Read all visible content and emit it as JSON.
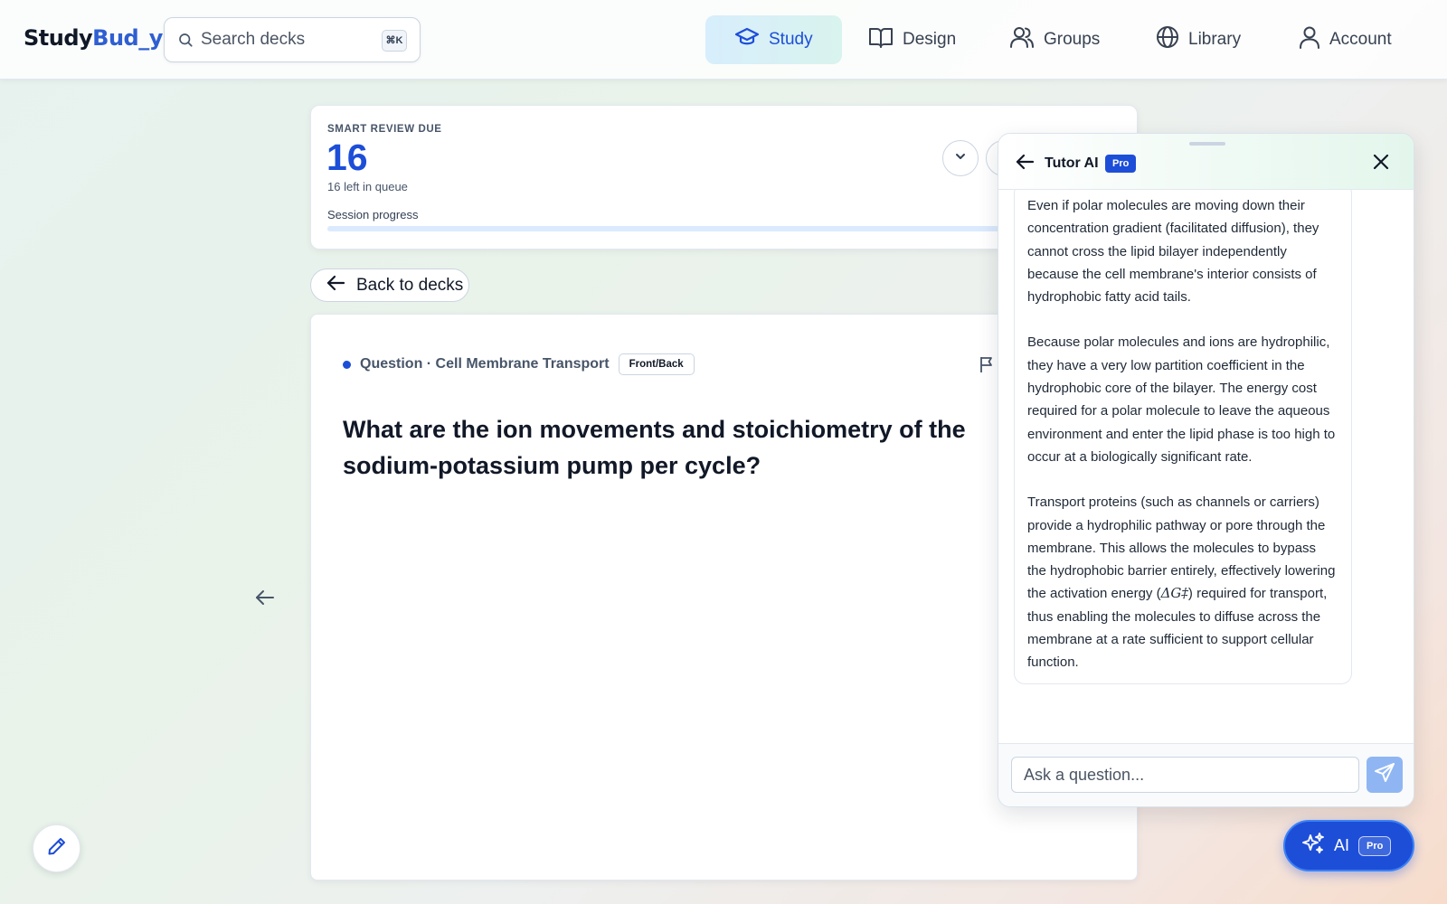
{
  "app": {
    "logo_part1": "Study",
    "logo_part2": "Bud",
    "logo_part3": "_y"
  },
  "search": {
    "placeholder": "Search decks",
    "shortcut": "⌘K"
  },
  "nav": {
    "items": [
      {
        "label": "Study",
        "icon": "graduation-cap-icon",
        "active": true
      },
      {
        "label": "Design",
        "icon": "book-open-icon"
      },
      {
        "label": "Groups",
        "icon": "users-icon"
      },
      {
        "label": "Library",
        "icon": "globe-icon"
      },
      {
        "label": "Account",
        "icon": "user-icon"
      }
    ]
  },
  "review": {
    "label": "SMART REVIEW DUE",
    "count": "16",
    "queue_text": "16 left in queue",
    "progress_label": "Session progress",
    "progress_fraction": 0.0
  },
  "back_button": {
    "label": "Back to decks"
  },
  "card": {
    "meta": "Question · Cell Membrane Transport",
    "type_chip": "Front/Back",
    "question": "What are the ion movements and stoichiometry of the sodium-potassium pump per cycle?"
  },
  "tutor": {
    "title": "Tutor AI",
    "badge": "Pro",
    "paragraphs": [
      "Even if polar molecules are moving down their concentration gradient (facilitated diffusion), they cannot cross the lipid bilayer independently because the cell membrane's interior consists of hydrophobic fatty acid tails.",
      "Because polar molecules and ions are hydrophilic, they have a very low partition coefficient in the hydrophobic core of the bilayer. The energy cost required for a polar molecule to leave the aqueous environment and enter the lipid phase is too high to occur at a biologically significant rate."
    ],
    "p3_before": "Transport proteins (such as channels or carriers) provide a hydrophilic pathway or pore through the membrane. This allows the molecules to bypass the hydrophobic barrier entirely, effectively lowering the activation energy (",
    "p3_math": "ΔG‡",
    "p3_after": ") required for transport, thus enabling the molecules to diffuse across the membrane at a rate sufficient to support cellular function.",
    "input_placeholder": "Ask a question..."
  },
  "ai_fab": {
    "label": "AI",
    "badge": "Pro"
  },
  "colors": {
    "accent": "#1d4ed8",
    "background_start": "#e7f1ef",
    "background_end": "#f7dccb"
  }
}
